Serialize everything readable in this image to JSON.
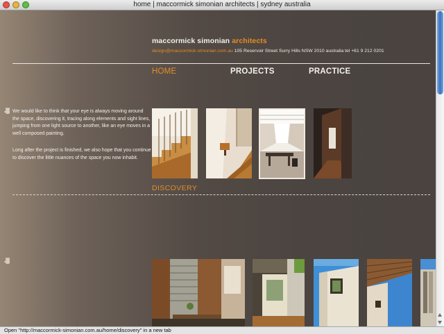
{
  "window": {
    "title": "home | maccormick simonian architects | sydney australia"
  },
  "header": {
    "brand_name": "maccormick simonian",
    "brand_suffix": "architects",
    "email": "design@maccormick-simonian.com.au",
    "address": "105 Reservoir Street Surry Hills NSW 2010 australia tel +61 9 212 0201"
  },
  "nav": {
    "home": "HOME",
    "projects": "PROJECTS",
    "practice": "PRACTICE"
  },
  "intro": {
    "paragraph_1": "We would like to think that your eye is always moving around the space, discovering it, tracing along elements and sight lines, jumping from one light source to another, like an eye moves in a well composed painting.",
    "paragraph_2": "Long after the project is finished, we also hope that you continue to discover the little nuances of the space you now inhabit."
  },
  "discovery": {
    "title": "DISCOVERY"
  },
  "status": {
    "text": "Open \"http://maccormick-simonian.com.au/home/discovery\" in a new tab"
  },
  "colors": {
    "accent": "#e38d26",
    "text_light": "#f3f0ec"
  },
  "icons": [
    "hand-pointer-icon"
  ]
}
